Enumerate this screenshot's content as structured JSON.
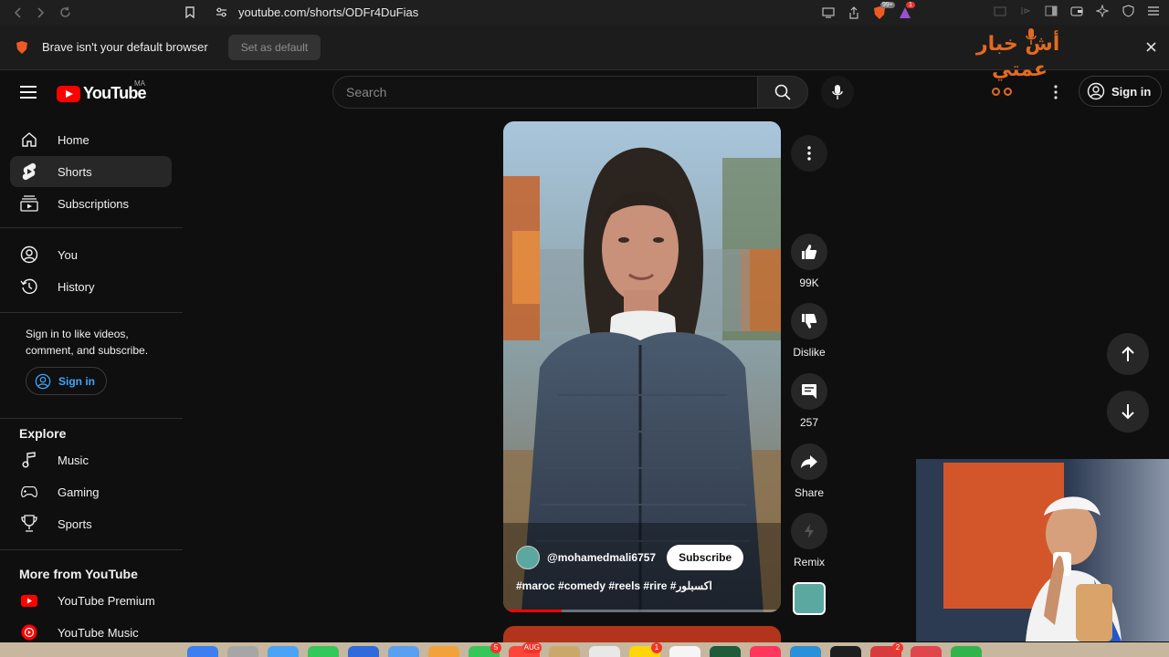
{
  "browser": {
    "url": "youtube.com/shorts/ODFr4DuFias",
    "shields_badge": "99+",
    "alert_badge": "1",
    "infobar_message": "Brave isn't your default browser",
    "set_default_label": "Set as default"
  },
  "watermark": {
    "line1": "أش خبار",
    "line2": "عمتي"
  },
  "header": {
    "logo_text": "YouTube",
    "country_code": "MA",
    "search_placeholder": "Search",
    "sign_in_label": "Sign in"
  },
  "sidebar": {
    "primary": [
      {
        "label": "Home",
        "icon": "home-icon"
      },
      {
        "label": "Shorts",
        "icon": "shorts-icon",
        "active": true
      },
      {
        "label": "Subscriptions",
        "icon": "subscriptions-icon"
      }
    ],
    "you": [
      {
        "label": "You",
        "icon": "account-icon"
      },
      {
        "label": "History",
        "icon": "history-icon"
      }
    ],
    "signin_message": "Sign in to like videos, comment, and subscribe.",
    "signin_label": "Sign in",
    "explore_heading": "Explore",
    "explore": [
      {
        "label": "Music",
        "icon": "music-icon"
      },
      {
        "label": "Gaming",
        "icon": "gaming-icon"
      },
      {
        "label": "Sports",
        "icon": "trophy-icon"
      }
    ],
    "more_heading": "More from YouTube",
    "more": [
      {
        "label": "YouTube Premium",
        "icon": "youtube-premium-icon"
      },
      {
        "label": "YouTube Music",
        "icon": "youtube-music-icon"
      }
    ]
  },
  "short": {
    "channel": "@mohamedmali6757",
    "subscribe_label": "Subscribe",
    "caption": "#maroc #comedy #reels #rire #اكسبلور",
    "progress": 0.21
  },
  "actions": {
    "likes": "99K",
    "dislike_label": "Dislike",
    "comments": "257",
    "share_label": "Share",
    "remix_label": "Remix"
  },
  "dock": {
    "badges": [
      "5",
      "AUG",
      "1",
      "2"
    ]
  },
  "colors": {
    "background": "#0f0f0f",
    "yt_red": "#ff0000",
    "link_blue": "#3ea6ff",
    "watermark_orange": "#e36a20"
  }
}
